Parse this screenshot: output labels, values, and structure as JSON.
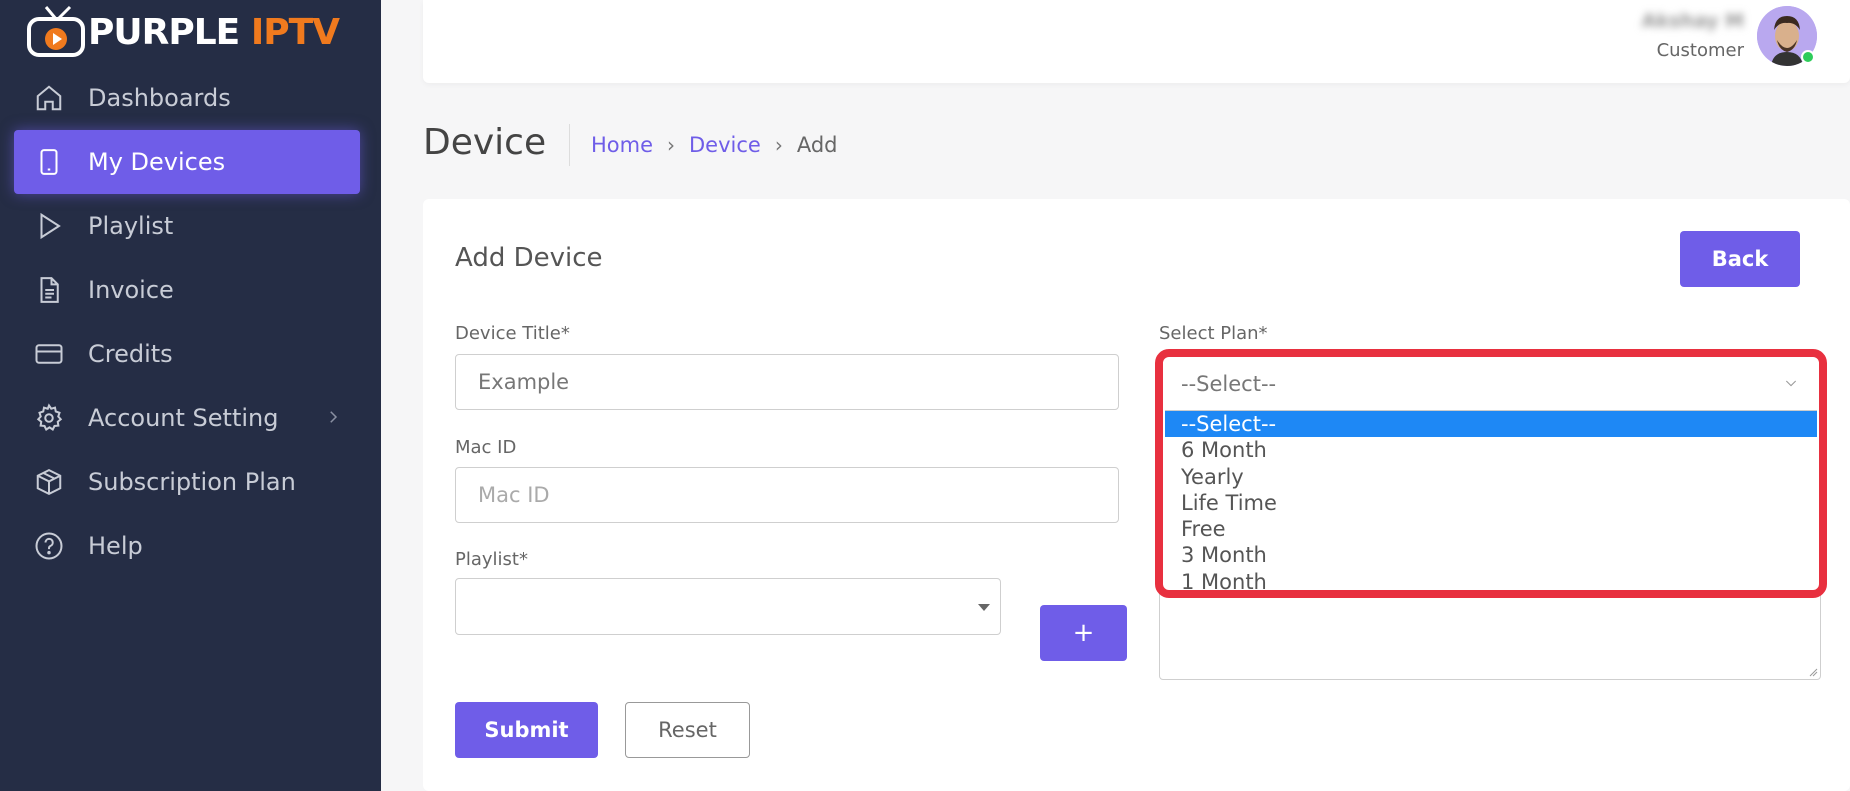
{
  "app": {
    "logo_part1": "PURPLE",
    "logo_part2": "IPTV"
  },
  "sidebar": {
    "items": [
      {
        "label": "Dashboards",
        "icon": "home-icon"
      },
      {
        "label": "My Devices",
        "icon": "mobile-icon",
        "active": true
      },
      {
        "label": "Playlist",
        "icon": "play-icon"
      },
      {
        "label": "Invoice",
        "icon": "document-icon"
      },
      {
        "label": "Credits",
        "icon": "credit-card-icon"
      },
      {
        "label": "Account Setting",
        "icon": "gear-icon",
        "has_submenu": true
      },
      {
        "label": "Subscription Plan",
        "icon": "box-icon"
      },
      {
        "label": "Help",
        "icon": "help-icon"
      }
    ]
  },
  "header": {
    "user_name": "Akshay M",
    "user_role": "Customer"
  },
  "page": {
    "title": "Device",
    "breadcrumb": [
      "Home",
      "Device",
      "Add"
    ]
  },
  "form": {
    "card_title": "Add Device",
    "back_label": "Back",
    "device_title_label": "Device Title*",
    "device_title_value": "Example",
    "mac_id_label": "Mac ID",
    "mac_id_placeholder": "Mac ID",
    "playlist_label": "Playlist*",
    "add_playlist_label": "+",
    "plan_label": "Select Plan*",
    "plan_selected": "--Select--",
    "plan_options": [
      "--Select--",
      "6 Month",
      "Yearly",
      "Life Time",
      "Free",
      "3 Month",
      "1 Month"
    ],
    "submit_label": "Submit",
    "reset_label": "Reset"
  },
  "colors": {
    "sidebar_bg": "#252d45",
    "accent": "#6f5de8",
    "logo_orange": "#f07a1e",
    "highlight_red": "#e8303f",
    "option_selected": "#1e88f5"
  }
}
